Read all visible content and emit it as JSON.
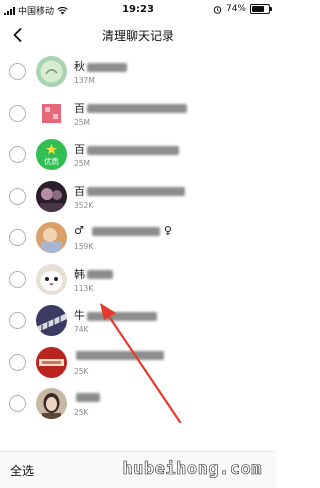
{
  "status_bar": {
    "carrier": "中国移动",
    "time": "19:23",
    "battery": "74%",
    "battery_level": 0.74
  },
  "nav": {
    "title": "清理聊天记录",
    "back_icon": "chevron-left-icon"
  },
  "contacts": [
    {
      "name": "秋",
      "size": "137M"
    },
    {
      "name": "百",
      "size": "25M"
    },
    {
      "name": "百",
      "size": "25M"
    },
    {
      "name": "百",
      "size": "352K"
    },
    {
      "name": "♂",
      "size": "159K"
    },
    {
      "name": "韩",
      "size": "113K"
    },
    {
      "name": "牛",
      "size": "74K"
    },
    {
      "name": "",
      "size": "25K"
    },
    {
      "name": "",
      "size": "25K"
    }
  ],
  "bottom": {
    "select_all": "全选",
    "watermark": "hubeihong.com"
  },
  "colors": {
    "accent_arrow": "#e63a2e",
    "avatar_badge_green": "#2fbf53"
  }
}
